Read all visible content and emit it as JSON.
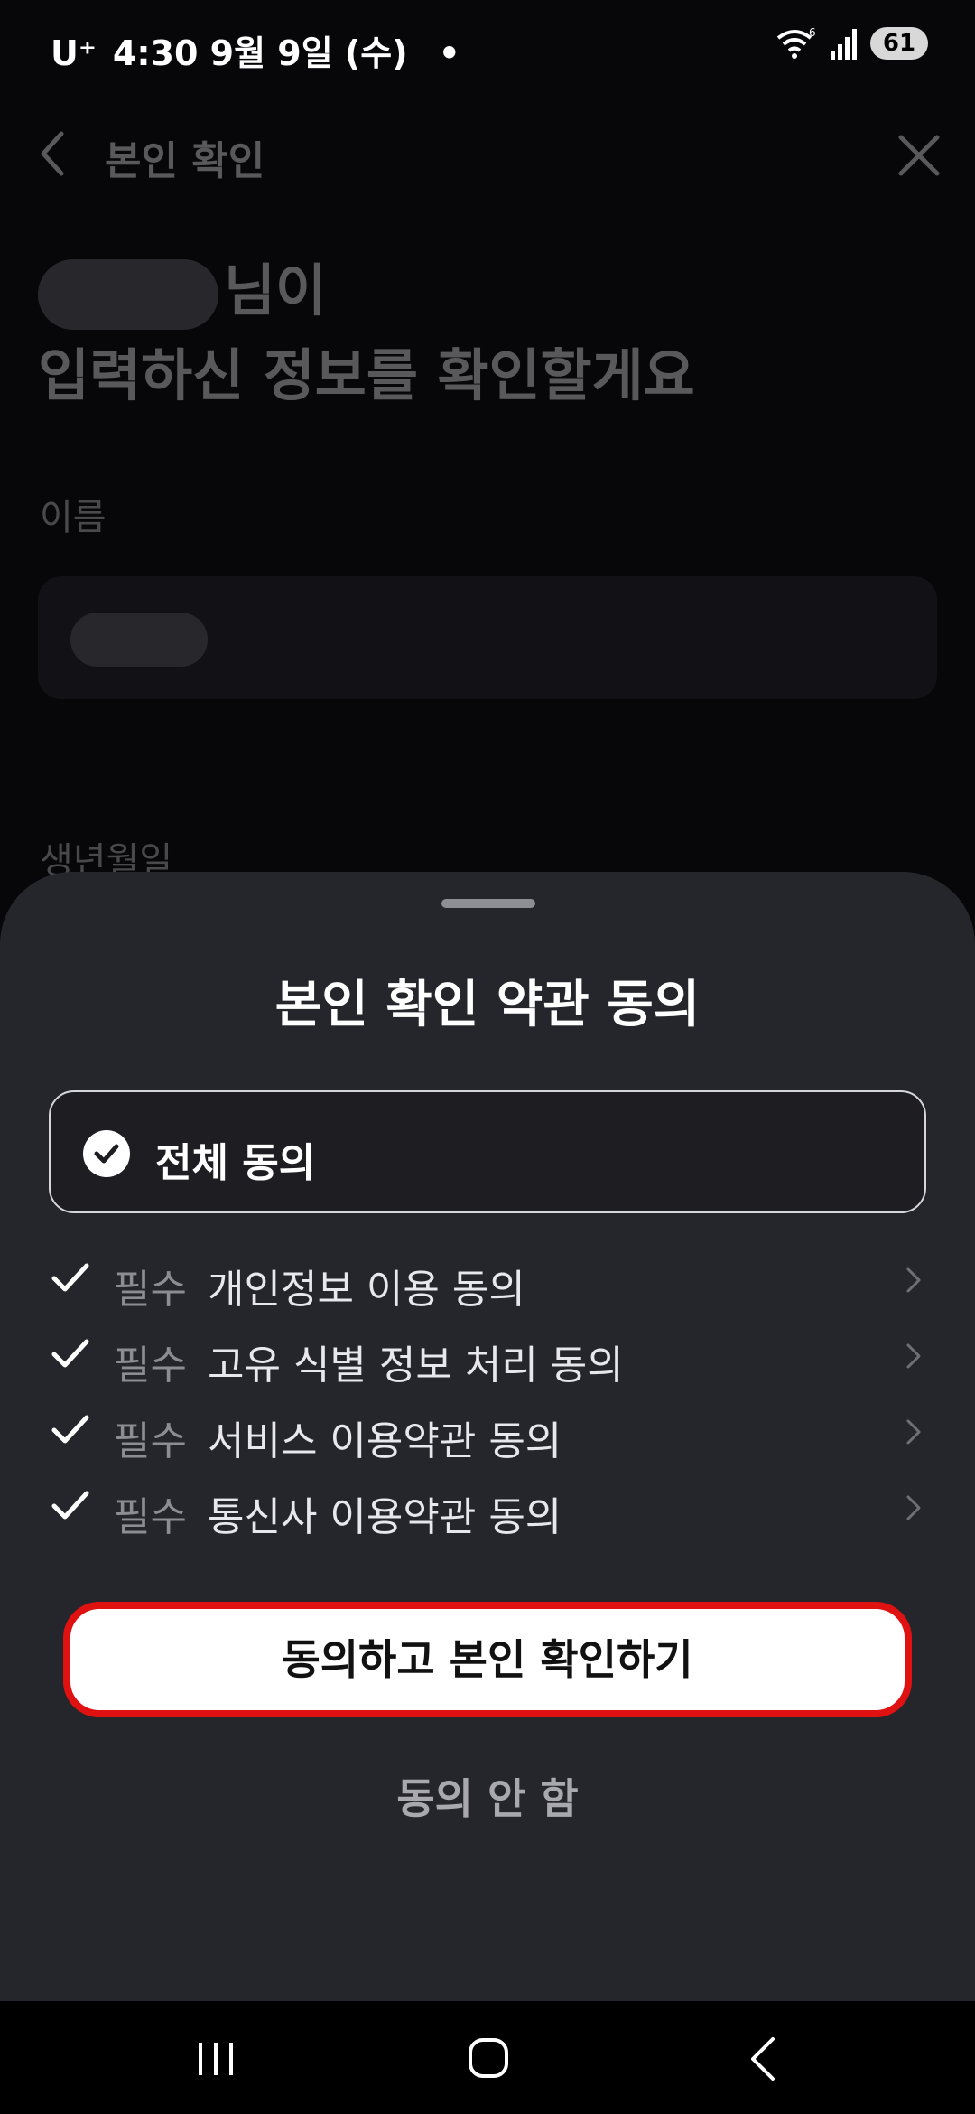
{
  "status_bar": {
    "carrier": "U⁺",
    "time_date": "4:30  9월 9일 (수)",
    "notification_dot": "•",
    "wifi_badge": "6",
    "battery": "61"
  },
  "background_page": {
    "header_title": "본인 확인",
    "headline_suffix": "님이",
    "headline_line2": "입력하신 정보를 확인할게요",
    "name_label": "이름",
    "birth_label": "생년월일"
  },
  "sheet": {
    "title": "본인 확인 약관 동의",
    "agree_all_label": "전체 동의",
    "terms": [
      {
        "required": "필수",
        "label": "개인정보 이용 동의"
      },
      {
        "required": "필수",
        "label": "고유 식별 정보 처리 동의"
      },
      {
        "required": "필수",
        "label": "서비스 이용약관 동의"
      },
      {
        "required": "필수",
        "label": "통신사 이용약관 동의"
      }
    ],
    "primary_button": "동의하고 본인 확인하기",
    "secondary_button": "동의 안 함"
  },
  "icons": {
    "back": "back-arrow-icon",
    "close": "close-icon",
    "check": "check-icon",
    "chevron": "chevron-right-icon",
    "nav_recent": "recent-apps-icon",
    "nav_home": "home-icon",
    "nav_back": "nav-back-icon"
  },
  "colors": {
    "sheet_bg": "#25262b",
    "highlight_border": "#e01111",
    "button_bg": "#ffffff"
  }
}
